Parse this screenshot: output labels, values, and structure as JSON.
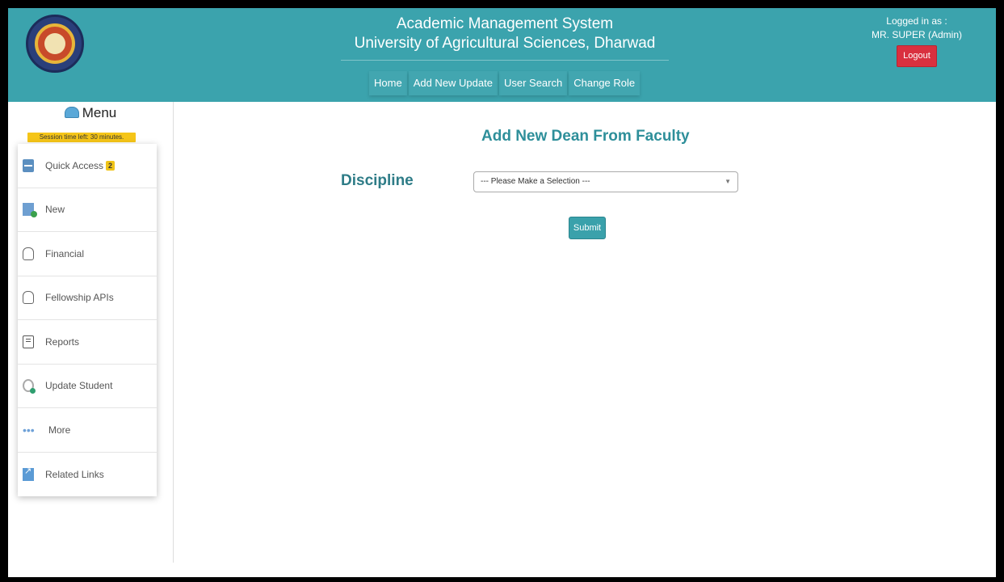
{
  "header": {
    "title_line1": "Academic Management System",
    "title_line2": "University of Agricultural Sciences, Dharwad",
    "nav": [
      "Home",
      "Add New Update",
      "User Search",
      "Change Role"
    ],
    "logged_in_label": "Logged in as :",
    "user": "MR. SUPER (Admin)",
    "logout": "Logout"
  },
  "sidebar": {
    "menu_title": "Menu",
    "session_text": "Session time left: 30 minutes.",
    "items": [
      {
        "label": "Quick Access",
        "icon": "quick-access-icon",
        "badge": "2"
      },
      {
        "label": "New",
        "icon": "new-icon"
      },
      {
        "label": "Financial",
        "icon": "financial-icon"
      },
      {
        "label": "Fellowship APIs",
        "icon": "fellowship-icon"
      },
      {
        "label": "Reports",
        "icon": "reports-icon"
      },
      {
        "label": "Update Student",
        "icon": "update-student-icon"
      },
      {
        "label": "More",
        "icon": "more-dots-icon"
      },
      {
        "label": "Related Links",
        "icon": "related-links-icon"
      }
    ]
  },
  "main": {
    "title": "Add New Dean From Faculty",
    "discipline_label": "Discipline",
    "discipline_select": "--- Please Make a Selection ---",
    "submit": "Submit"
  },
  "colors": {
    "header_bg": "#3ba3ad",
    "logout_bg": "#d9303f",
    "title_color": "#2e8f9a",
    "session_bg": "#f5c518"
  }
}
